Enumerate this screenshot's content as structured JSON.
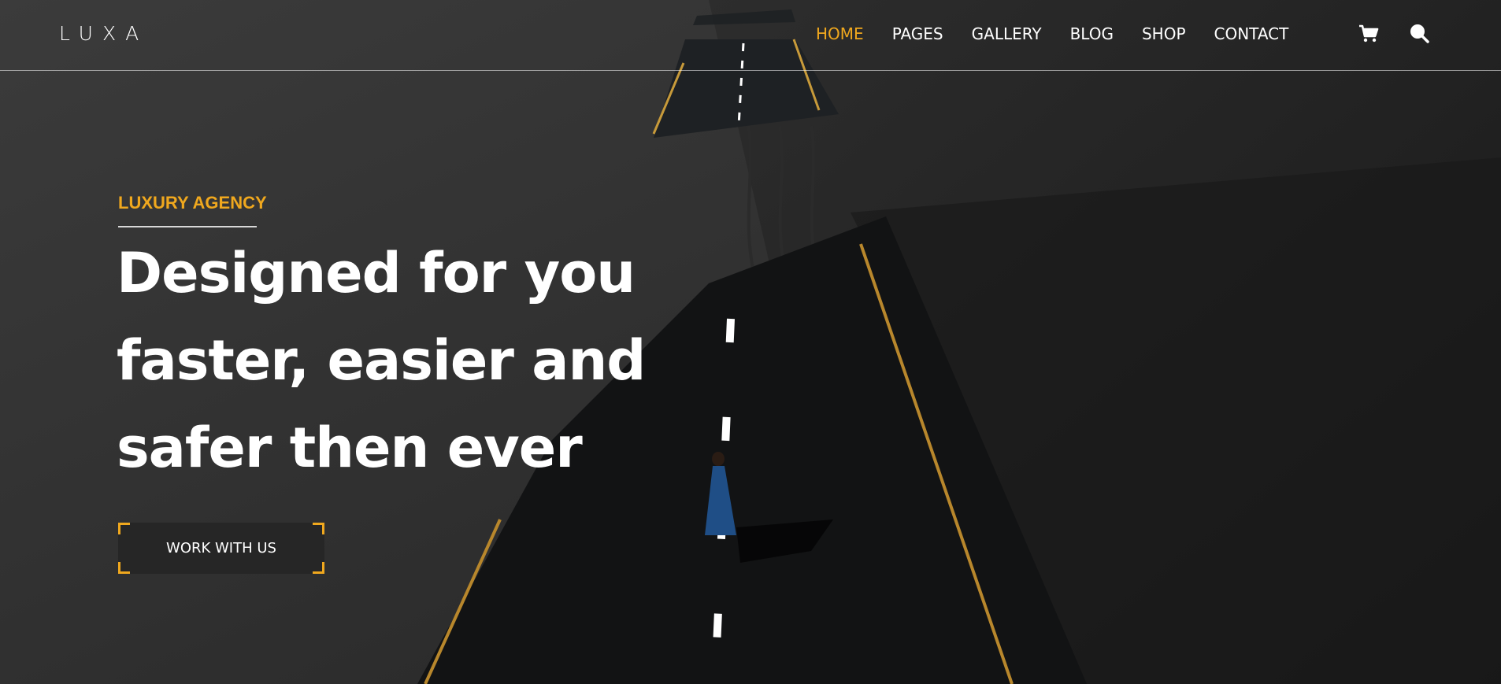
{
  "brand": {
    "logo": "LUXA",
    "accent_color": "#f0a81e"
  },
  "nav": {
    "items": [
      {
        "label": "HOME",
        "active": true
      },
      {
        "label": "PAGES",
        "active": false
      },
      {
        "label": "GALLERY",
        "active": false
      },
      {
        "label": "BLOG",
        "active": false
      },
      {
        "label": "SHOP",
        "active": false
      },
      {
        "label": "CONTACT",
        "active": false
      }
    ],
    "icons": [
      "cart-icon",
      "search-icon"
    ]
  },
  "hero": {
    "eyebrow": "LUXURY AGENCY",
    "headline_lines": [
      "Designed for you",
      "faster, easier and",
      "safer then ever"
    ],
    "cta_label": "WORK WITH US",
    "background_image": "road-through-dark-sand-dunes"
  }
}
